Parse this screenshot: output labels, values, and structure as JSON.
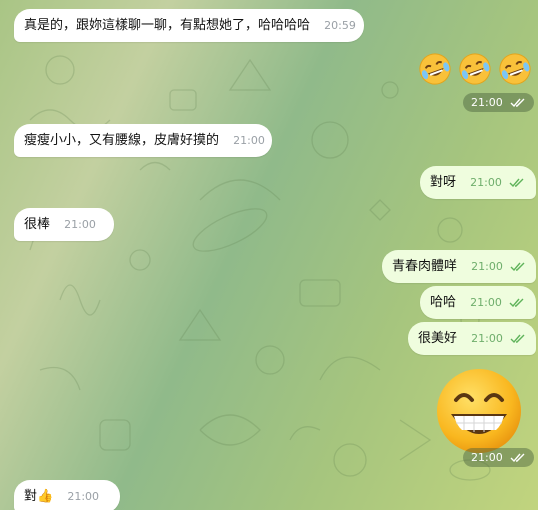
{
  "messages": [
    {
      "side": "in",
      "text": "真是的，跟妳這樣聊一聊，有點想她了，哈哈哈哈",
      "time": "20:59"
    },
    {
      "side": "out_emoji",
      "emoji": [
        "rofl-emoji",
        "rofl-emoji",
        "rofl-emoji"
      ],
      "time": "21:00"
    },
    {
      "side": "in",
      "text": "瘦瘦小小，又有腰線，皮膚好摸的",
      "time": "21:00"
    },
    {
      "side": "out",
      "text": "對呀",
      "time": "21:00"
    },
    {
      "side": "in",
      "text": "很棒",
      "time": "21:00"
    },
    {
      "side": "out",
      "text": "青春肉體咩",
      "time": "21:00"
    },
    {
      "side": "out",
      "text": "哈哈",
      "time": "21:00"
    },
    {
      "side": "out",
      "text": "很美好",
      "time": "21:00"
    },
    {
      "side": "out_sticker",
      "emoji": "grinning-face-emoji",
      "time": "21:00"
    },
    {
      "side": "in",
      "text": "對👍",
      "time": "21:00"
    }
  ],
  "colors": {
    "incoming_bubble": "#ffffff",
    "outgoing_bubble": "#effdde",
    "read_ticks": "#5fb35a"
  }
}
